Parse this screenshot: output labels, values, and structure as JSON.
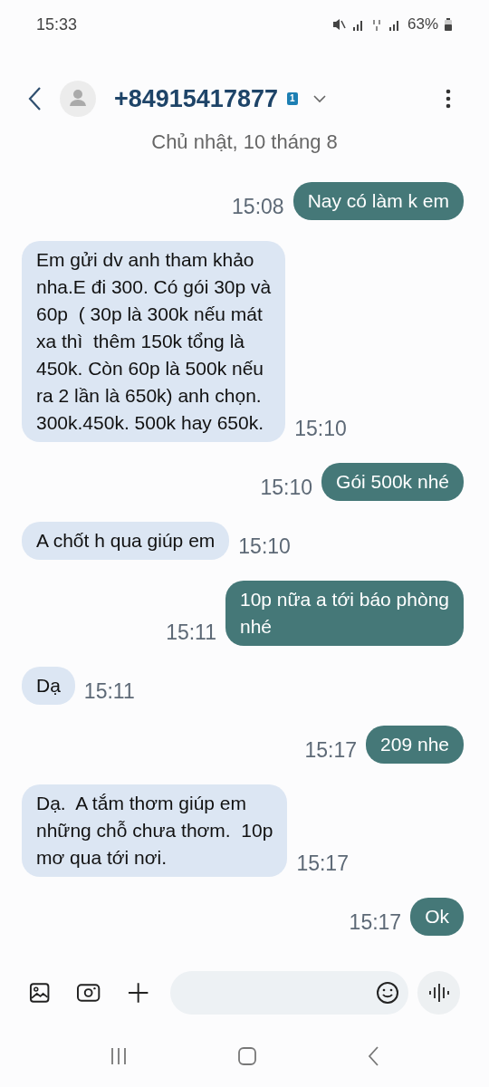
{
  "status_bar": {
    "time": "15:33",
    "battery": "63%"
  },
  "header": {
    "contact": "+84915417877",
    "sim_badge": "1"
  },
  "date_divider": "Chủ nhật, 10 tháng 8",
  "messages": [
    {
      "kind": "sent",
      "text": "Nay có làm k em",
      "time": "15:08"
    },
    {
      "kind": "received",
      "text": "Em gửi dv anh tham khảo\nnha.E đi 300. Có gói 30p và\n60p  ( 30p là 300k nếu mát\nxa thì  thêm 150k tổng là\n450k. Còn 60p là 500k nếu\nra 2 lần là 650k) anh chọn.\n300k.450k. 500k hay 650k.",
      "time": "15:10"
    },
    {
      "kind": "sent",
      "text": "Gói 500k nhé",
      "time": "15:10"
    },
    {
      "kind": "received",
      "text": "A chốt h qua giúp em",
      "time": "15:10"
    },
    {
      "kind": "sent",
      "text": "10p nữa a tới báo phòng\nnhé",
      "time": "15:11"
    },
    {
      "kind": "received",
      "text": "Dạ",
      "time": "15:11"
    },
    {
      "kind": "sent",
      "text": "209 nhe",
      "time": "15:17"
    },
    {
      "kind": "received",
      "text": "Dạ.  A tắm thơm giúp em\nnhững chỗ chưa thơm.  10p\nmơ qua tới nơi.",
      "time": "15:17"
    },
    {
      "kind": "sent",
      "text": "Ok",
      "time": "15:17"
    }
  ]
}
